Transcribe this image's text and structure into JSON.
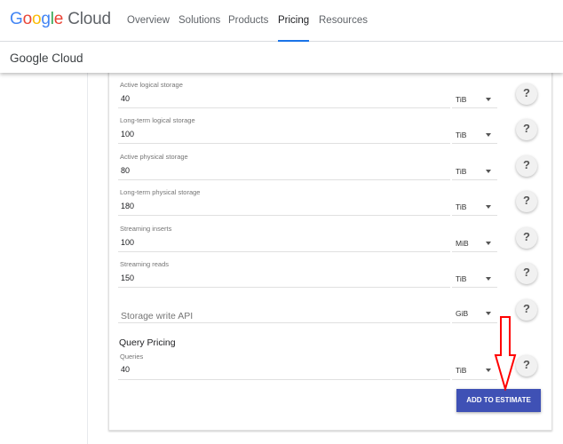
{
  "topnav": {
    "logo": "Google Cloud",
    "items": [
      {
        "label": "Overview"
      },
      {
        "label": "Solutions"
      },
      {
        "label": "Products"
      },
      {
        "label": "Pricing",
        "active": true
      },
      {
        "label": "Resources"
      }
    ]
  },
  "subheader": {
    "title": "Google Cloud"
  },
  "storage_pricing": {
    "rows": [
      {
        "label": "Active logical storage",
        "value": "40",
        "unit": "TiB"
      },
      {
        "label": "Long-term logical storage",
        "value": "100",
        "unit": "TiB"
      },
      {
        "label": "Active physical storage",
        "value": "80",
        "unit": "TiB"
      },
      {
        "label": "Long-term physical storage",
        "value": "180",
        "unit": "TiB"
      },
      {
        "label": "Streaming inserts",
        "value": "100",
        "unit": "MiB"
      },
      {
        "label": "Streaming reads",
        "value": "150",
        "unit": "TiB"
      }
    ],
    "write_api": {
      "placeholder": "Storage write API",
      "unit": "GiB"
    }
  },
  "query_pricing": {
    "heading": "Query Pricing",
    "label": "Queries",
    "value": "40",
    "unit": "TiB"
  },
  "help_glyph": "?",
  "add_button": "ADD TO ESTIMATE",
  "colors": {
    "accent": "#3f51b5",
    "annotation": "#ff0000",
    "nav_active": "#1a73e8"
  }
}
